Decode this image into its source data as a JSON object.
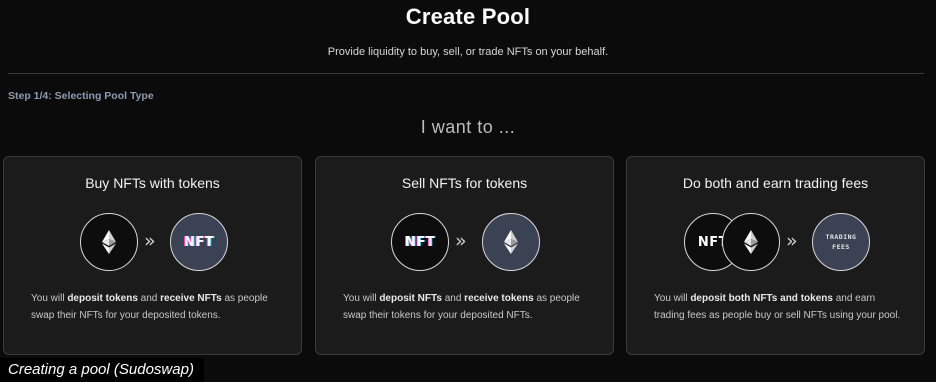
{
  "header": {
    "title": "Create Pool",
    "subtitle": "Provide liquidity to buy, sell, or trade NFTs on your behalf."
  },
  "step_label": "Step 1/4: Selecting Pool Type",
  "prompt": "I want to ...",
  "cards": [
    {
      "title": "Buy NFTs with tokens",
      "icons": [
        "eth-icon",
        "chevrons-right-icon",
        "nft-icon"
      ],
      "nft_label": "NFT",
      "desc": {
        "p1": "You will ",
        "b1": "deposit tokens",
        "p2": " and ",
        "b2": "receive NFTs",
        "p3": " as people swap their NFTs for your deposited tokens."
      }
    },
    {
      "title": "Sell NFTs for tokens",
      "icons": [
        "nft-icon",
        "chevrons-right-icon",
        "eth-icon"
      ],
      "nft_label": "NFT",
      "desc": {
        "p1": "You will ",
        "b1": "deposit NFTs",
        "p2": " and ",
        "b2": "receive tokens",
        "p3": " as people swap their tokens for your deposited NFTs."
      }
    },
    {
      "title": "Do both and earn trading fees",
      "icons": [
        "nft-icon",
        "eth-icon",
        "chevrons-right-icon",
        "trading-fees-icon"
      ],
      "nft_label": "NFT",
      "fees_line1": "TRADING",
      "fees_line2": "FEES",
      "desc": {
        "p1": "You will ",
        "b1": "deposit both NFTs and tokens",
        "p2": " and earn trading fees as people buy or sell NFTs using your pool.",
        "b2": "",
        "p3": ""
      }
    }
  ],
  "caption": "Creating a pool (Sudoswap)",
  "colors": {
    "background": "#0b0b0b",
    "card": "#1b1b1b",
    "step_label": "#8e9bb0",
    "circle_blue": "#3a4254"
  }
}
